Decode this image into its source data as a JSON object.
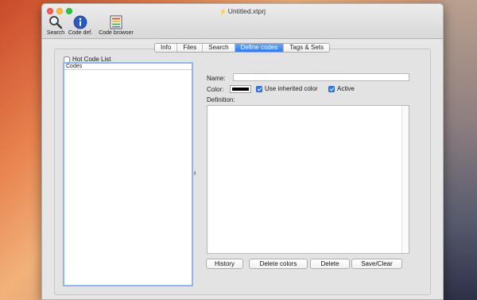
{
  "window": {
    "title": "Untitled.xtprj"
  },
  "toolbar": {
    "items": [
      {
        "label": "Search",
        "icon": "magnifier-icon"
      },
      {
        "label": "Code def.",
        "icon": "info-icon"
      },
      {
        "label": "Code browser",
        "icon": "list-icon"
      }
    ]
  },
  "tabs": [
    {
      "label": "Info",
      "active": false
    },
    {
      "label": "Files",
      "active": false
    },
    {
      "label": "Search",
      "active": false
    },
    {
      "label": "Define codes",
      "active": true
    },
    {
      "label": "Tags & Sets",
      "active": false
    }
  ],
  "left": {
    "hot_code_list_label": "Hot Code List",
    "hot_code_list_checked": false,
    "list_header": "Codes"
  },
  "form": {
    "name_label": "Name:",
    "name_value": "",
    "color_label": "Color:",
    "color_value": "#000000",
    "use_inherited_label": "Use inherited color",
    "use_inherited_checked": true,
    "active_label": "Active",
    "active_checked": true,
    "definition_label": "Definition:",
    "definition_value": ""
  },
  "buttons": {
    "history": "History",
    "delete_colors": "Delete colors",
    "delete": "Delete",
    "save_clear": "Save/Clear"
  },
  "colors": {
    "accent": "#2d7bf0",
    "list_focus_border": "#8fb6ef"
  }
}
